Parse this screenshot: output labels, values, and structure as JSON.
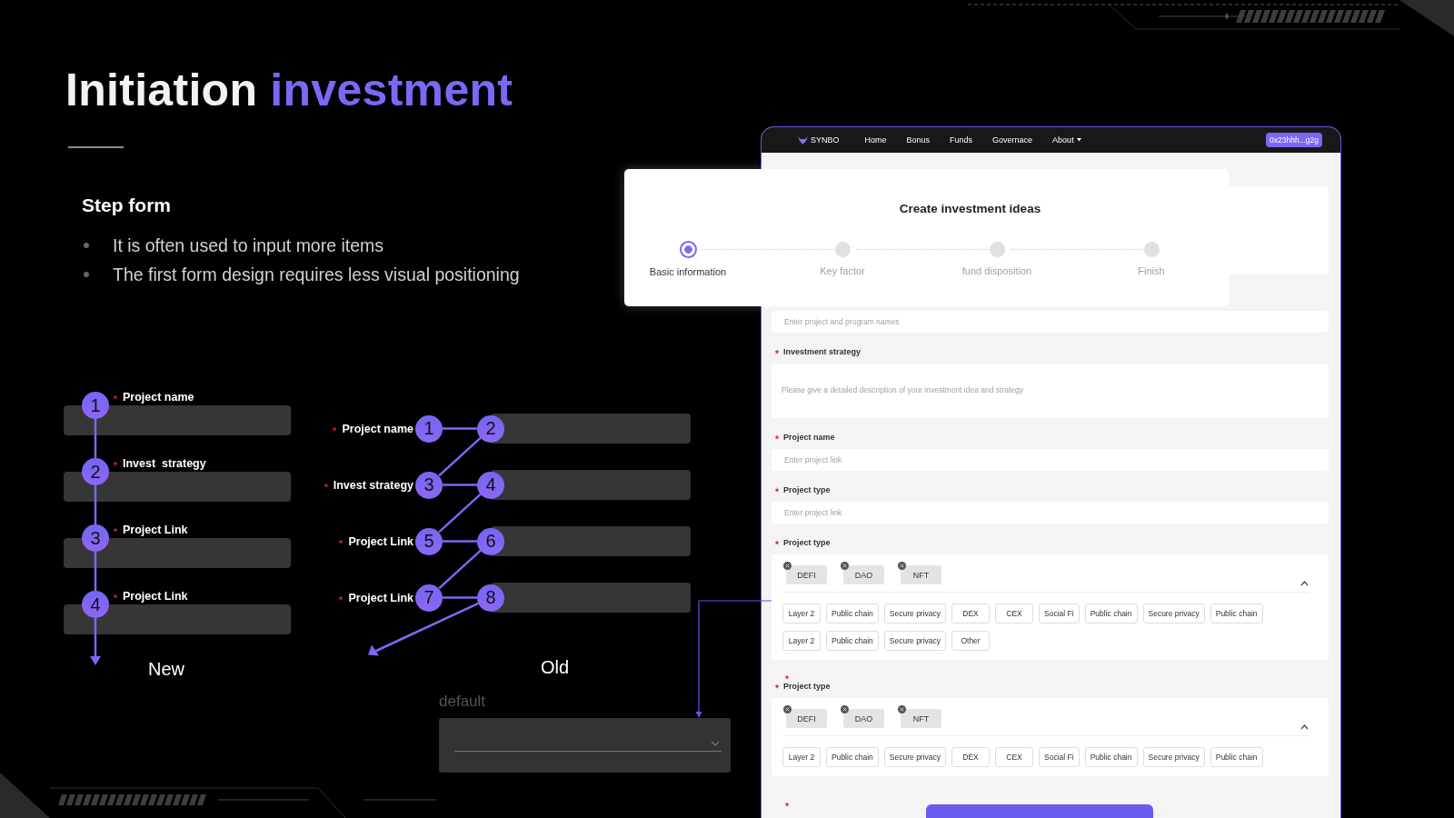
{
  "title_parts": [
    {
      "text": "Initiation",
      "accent": false
    },
    {
      "text": "investment",
      "accent": true
    }
  ],
  "section": {
    "heading": "Step form",
    "bullets": [
      "It is often used to input more items",
      "The first form design requires less visual positioning"
    ]
  },
  "new_diagram": {
    "caption": "New",
    "rows": [
      {
        "label": "Project name",
        "marker": "1"
      },
      {
        "label": "Invest  strategy",
        "marker": "2"
      },
      {
        "label": "Project Link",
        "marker": "3"
      },
      {
        "label": "Project Link",
        "marker": "4"
      }
    ]
  },
  "old_diagram": {
    "caption": "Old",
    "rows": [
      {
        "label": "Project name",
        "markers": [
          "1",
          "2"
        ]
      },
      {
        "label": "Invest strategy",
        "markers": [
          "3",
          "4"
        ]
      },
      {
        "label": "Project Link",
        "markers": [
          "5",
          "6"
        ]
      },
      {
        "label": "Project Link",
        "markers": [
          "7",
          "8"
        ]
      }
    ]
  },
  "default_select": {
    "label": "default"
  },
  "mockup": {
    "nav": {
      "logo": "SYNBO",
      "links": [
        {
          "label": "Home",
          "dropdown": false
        },
        {
          "label": "Bonus",
          "dropdown": false
        },
        {
          "label": "Funds",
          "dropdown": false
        },
        {
          "label": "Governace",
          "dropdown": false
        },
        {
          "label": "About",
          "dropdown": true
        }
      ],
      "wallet": "0x23hhh...g2g"
    },
    "modal": {
      "title": "Create investment ideas",
      "steps": [
        {
          "label": "Basic information",
          "selected": true
        },
        {
          "label": "Key factor",
          "selected": false
        },
        {
          "label": "fund disposition",
          "selected": false
        },
        {
          "label": "Finish",
          "selected": false
        }
      ]
    },
    "form": [
      {
        "kind": "input",
        "placeholder": "Enter project and program names"
      },
      {
        "kind": "textarea",
        "label": "Investment strategy",
        "required": true,
        "placeholder": "Please give a detailed description of your investment idea and strategy"
      },
      {
        "kind": "input",
        "label": "Project name",
        "required": true,
        "placeholder": "Enter project link"
      },
      {
        "kind": "input",
        "label": "Project type",
        "required": true,
        "placeholder": "Enter project link"
      },
      {
        "kind": "tags",
        "label": "Project type",
        "required": true,
        "chips": [
          "DEFI",
          "DAO",
          "NFT"
        ],
        "options": [
          "Layer 2",
          "Public chain",
          "Secure privacy",
          "DEX",
          "CEX",
          "Social Fi",
          "Public chain",
          "Secure privacy",
          "Public chain",
          "Layer 2",
          "Public chain",
          "Secure privacy",
          "Other"
        ]
      },
      {
        "kind": "tags",
        "label": "Project type",
        "required": true,
        "stray_mark": true,
        "chips": [
          "DEFI",
          "DAO",
          "NFT"
        ],
        "options": [
          "Layer 2",
          "Public chain",
          "Secure privacy",
          "DEX",
          "CEX",
          "Social Fi",
          "Public chain",
          "Secure privacy",
          "Public chain"
        ]
      },
      {
        "kind": "button",
        "required": true
      }
    ]
  }
}
